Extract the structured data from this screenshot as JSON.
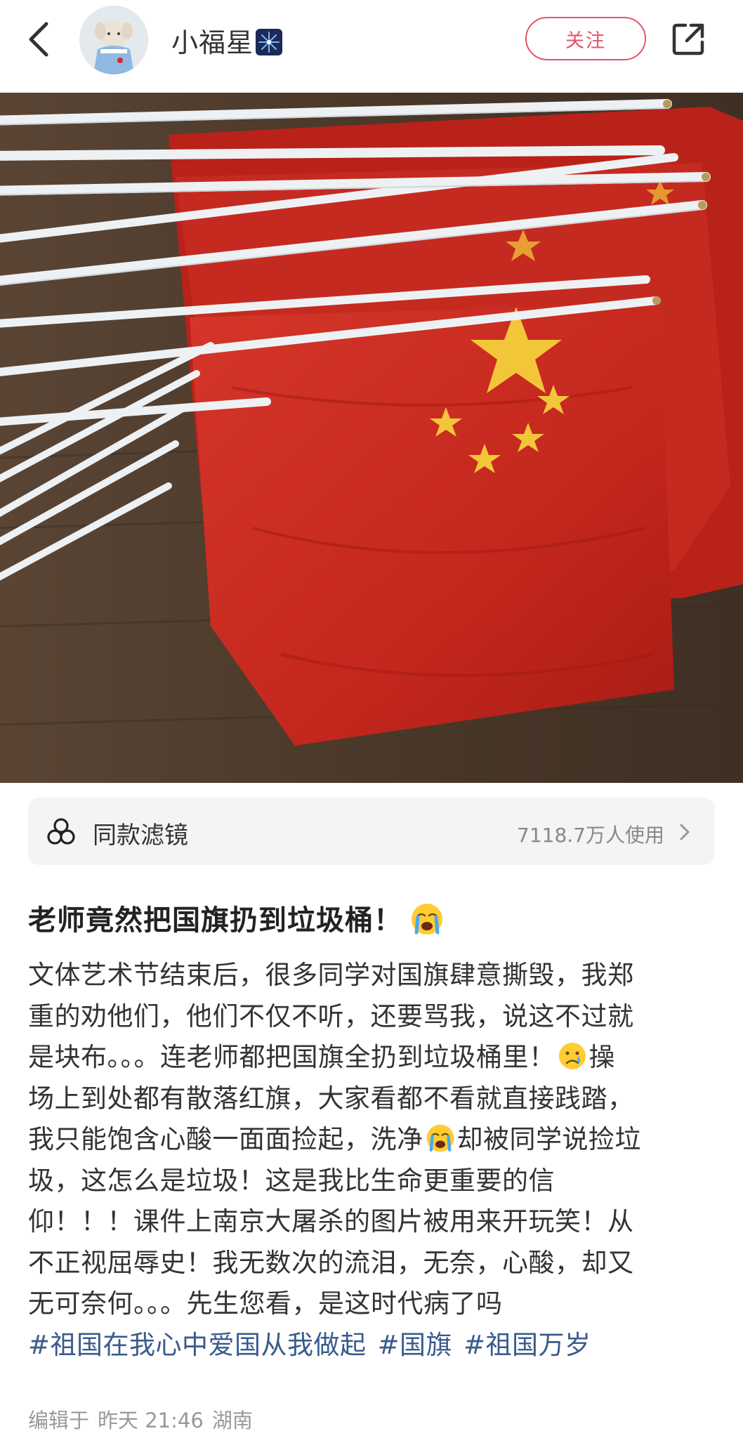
{
  "header": {
    "username": "小福星",
    "follow_label": "关注"
  },
  "filter": {
    "label": "同款滤镜",
    "count": "7118.7万人使用"
  },
  "post": {
    "title": "老师竟然把国旗扔到垃圾桶！",
    "body_lines": [
      [
        "文体艺术节结束后，很多同学对国旗肆意撕毁，我郑"
      ],
      [
        "重的劝他们，他们不仅不听，还要骂我，说这不过就"
      ],
      [
        "是块布。。。连老师都把国旗全扔到垃圾桶里！",
        "操"
      ],
      [
        "场上到处都有散落红旗，大家看都不看就直接践踏，"
      ],
      [
        "我只能饱含心酸一面面捡起，洗净",
        "却被同学说捡垃"
      ],
      [
        "圾，这怎么是垃圾！这是我比生命更重要的信"
      ],
      [
        "仰！！！课件上南京大屠杀的图片被用来开玩笑！从"
      ],
      [
        "不正视屈辱史！我无数次的流泪，无奈，心酸，却又"
      ],
      [
        "无可奈何。。。先生您看，是这时代病了吗"
      ]
    ],
    "tags": [
      "#祖国在我心中爱国从我做起",
      "#国旗",
      "#祖国万岁"
    ],
    "meta": {
      "edited_prefix": "编辑于",
      "time": "昨天 21:46",
      "location": "湖南"
    }
  },
  "colors": {
    "accent": "#e5536a",
    "tag": "#3a5b8c",
    "flag_red": "#c8261d",
    "star_yellow": "#f3c63a"
  },
  "icons": {
    "back": "chevron-left-icon",
    "share": "share-external-icon",
    "filter": "three-circles-filter-icon",
    "title_emoji": "loudly-crying-face-emoji",
    "sad_emoji": "crying-face-emoji"
  }
}
